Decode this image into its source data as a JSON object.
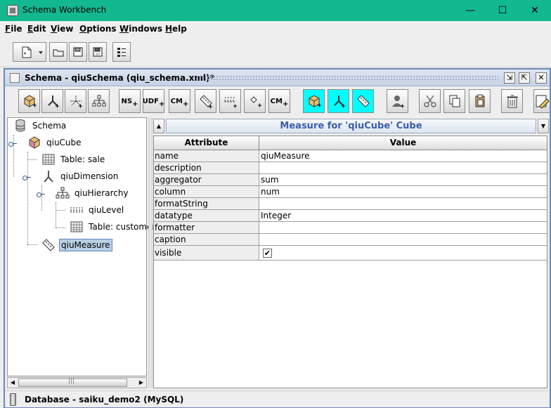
{
  "window": {
    "title": "Schema Workbench",
    "minimize": "—",
    "maximize": "☐",
    "close": "✕"
  },
  "menubar": {
    "items": [
      {
        "mnemonic": "F",
        "rest": "ile"
      },
      {
        "mnemonic": "E",
        "rest": "dit"
      },
      {
        "mnemonic": "V",
        "rest": "iew"
      },
      {
        "mnemonic": "O",
        "rest": "ptions"
      },
      {
        "mnemonic": "W",
        "rest": "indows"
      },
      {
        "mnemonic": "H",
        "rest": "elp"
      }
    ]
  },
  "main_toolbar": {
    "icons": [
      "new-icon",
      "dropdown-arrow-icon",
      "open-icon",
      "save-icon",
      "save-as-icon",
      "preferences-icon"
    ]
  },
  "internal_frame": {
    "title": "Schema - qiuSchema (qiu_schema.xml)*"
  },
  "schema_toolbar": {
    "buttons": [
      {
        "name": "add-cube",
        "label": "",
        "highlight": false
      },
      {
        "name": "add-dimension",
        "label": "",
        "highlight": false
      },
      {
        "name": "add-dimension-usage",
        "label": "",
        "highlight": false
      },
      {
        "name": "add-hierarchy",
        "label": "",
        "highlight": false
      },
      {
        "name": "add-named-set",
        "label": "NS",
        "highlight": false
      },
      {
        "name": "add-udf",
        "label": "UDF",
        "highlight": false
      },
      {
        "name": "add-calculated-member",
        "label": "CM",
        "highlight": false
      },
      {
        "name": "add-measure",
        "label": "",
        "highlight": false
      },
      {
        "name": "add-level",
        "label": "",
        "highlight": false
      },
      {
        "name": "add-property",
        "label": "",
        "highlight": false
      },
      {
        "name": "add-cube-measure",
        "label": "CM",
        "highlight": false
      },
      {
        "name": "add-virtual-cube",
        "label": "",
        "highlight": true
      },
      {
        "name": "add-virtual-dimension",
        "label": "",
        "highlight": true
      },
      {
        "name": "add-virtual-measure",
        "label": "",
        "highlight": true
      },
      {
        "name": "add-role",
        "label": "",
        "highlight": false
      },
      {
        "name": "cut",
        "label": "",
        "highlight": false
      },
      {
        "name": "copy",
        "label": "",
        "highlight": false
      },
      {
        "name": "paste",
        "label": "",
        "highlight": false
      },
      {
        "name": "delete",
        "label": "",
        "highlight": false
      },
      {
        "name": "edit-mode",
        "label": "",
        "highlight": false
      }
    ]
  },
  "tree": {
    "nodes": [
      {
        "label": "Schema",
        "icon": "database-icon"
      },
      {
        "label": "qiuCube",
        "icon": "cube-icon"
      },
      {
        "label": "Table: sale",
        "icon": "table-icon"
      },
      {
        "label": "qiuDimension",
        "icon": "dimension-icon"
      },
      {
        "label": "qiuHierarchy",
        "icon": "hierarchy-icon"
      },
      {
        "label": "qiuLevel",
        "icon": "level-icon"
      },
      {
        "label": "Table: customer",
        "icon": "table-icon"
      },
      {
        "label": "qiuMeasure",
        "icon": "measure-icon",
        "selected": true
      }
    ]
  },
  "properties": {
    "title": "Measure for 'qiuCube' Cube",
    "col_attribute": "Attribute",
    "col_value": "Value",
    "rows": [
      {
        "attr": "name",
        "value": "qiuMeasure"
      },
      {
        "attr": "description",
        "value": ""
      },
      {
        "attr": "aggregator",
        "value": "sum"
      },
      {
        "attr": "column",
        "value": "num"
      },
      {
        "attr": "formatString",
        "value": ""
      },
      {
        "attr": "datatype",
        "value": "Integer"
      },
      {
        "attr": "formatter",
        "value": ""
      },
      {
        "attr": "caption",
        "value": ""
      },
      {
        "attr": "visible",
        "value": "",
        "checked": true
      }
    ]
  },
  "status": {
    "text": "Database - saiku_demo2 (MySQL)"
  },
  "colors": {
    "titlebar": "#12b88f",
    "frame_border": "#6b88b8",
    "highlight_button": "#00ffff",
    "selection": "#b8cfe5",
    "panel_title_text": "#3b5ea8"
  }
}
